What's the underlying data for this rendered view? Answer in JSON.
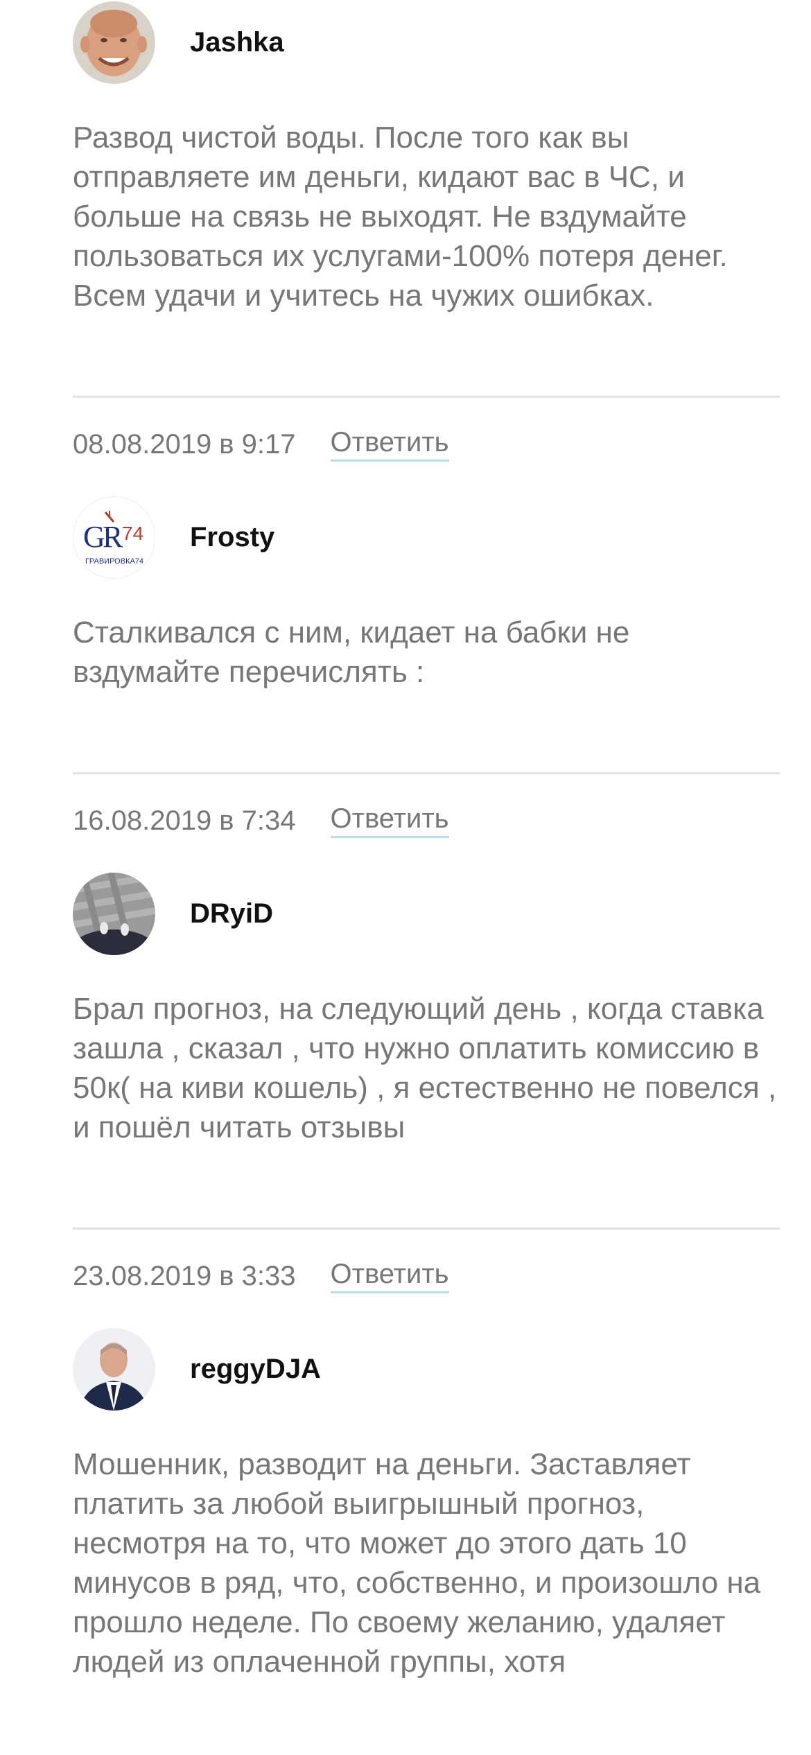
{
  "reply_label": "Ответить",
  "comments": [
    {
      "author": "Jashka",
      "text": "Развод чистой воды. После того как вы отправляете им деньги, кидают вас в ЧС, и больше на связь не выходят. Не вздумайте пользоваться их услугами-100% потеря денег. Всем удачи и учитесь на чужих ошибках.",
      "date": "08.08.2019 в 9:17"
    },
    {
      "author": "Frosty",
      "avatar_text": "ГРАВИРОВКА74",
      "text": "Сталкивался с ним, кидает на бабки не вздумайте перечислять :",
      "date": "16.08.2019 в 7:34"
    },
    {
      "author": "DRyiD",
      "text": "Брал прогноз, на следующий день , когда ставка зашла , сказал , что нужно оплатить комиссию в 50к( на киви кошель) , я естественно не повелся , и пошёл читать отзывы",
      "date": "23.08.2019 в 3:33"
    },
    {
      "author": "reggyDJA",
      "text": "Мошенник, разводит на деньги. Заставляет платить за любой выигрышный прогноз, несмотря на то, что может до этого дать 10 минусов в ряд, что, собственно, и произошло на прошло неделе. По своему желанию, удаляет людей из оплаченной группы, хотя"
    }
  ],
  "colors": {
    "body_text": "#777777",
    "author_text": "#111111",
    "divider": "#e3e3e3",
    "link_underline": "#b8dcef"
  }
}
